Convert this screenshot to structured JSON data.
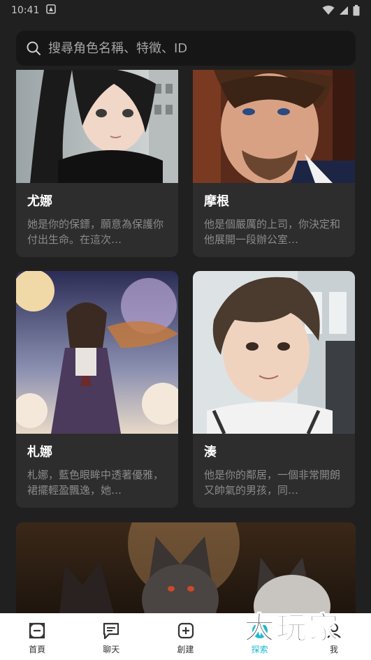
{
  "status_bar": {
    "time": "10:41"
  },
  "search": {
    "placeholder": "搜尋角色名稱、特徵、ID"
  },
  "characters": [
    {
      "name": "尤娜",
      "description": "她是你的保鏢，願意為保護你付出生命。在這次…"
    },
    {
      "name": "摩根",
      "description": "他是個嚴厲的上司，你決定和他展開一段辦公室…"
    },
    {
      "name": "札娜",
      "description": "札娜，藍色眼眸中透著優雅，裙擺輕盈飄逸，她…"
    },
    {
      "name": "湊",
      "description": "他是你的鄰居，一個非常開朗又帥氣的男孩，同…"
    }
  ],
  "bottom_nav": {
    "items": [
      {
        "label": "首頁",
        "icon": "home-icon"
      },
      {
        "label": "聊天",
        "icon": "chat-icon"
      },
      {
        "label": "創建",
        "icon": "create-icon"
      },
      {
        "label": "探索",
        "icon": "explore-icon"
      },
      {
        "label": "我",
        "icon": "profile-icon"
      }
    ],
    "active_index": 3,
    "active_color": "#22b8cf"
  },
  "watermark": {
    "text": "大玩家"
  }
}
